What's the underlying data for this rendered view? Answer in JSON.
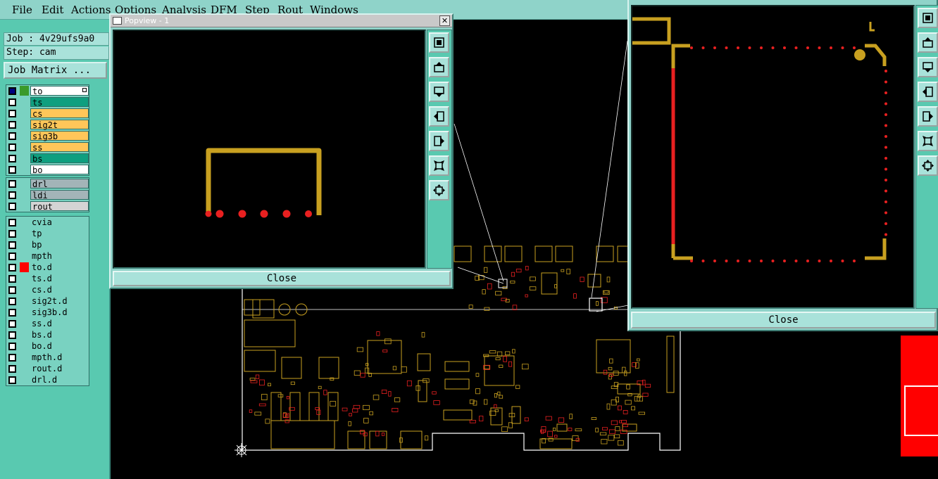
{
  "menu": [
    "File",
    "Edit",
    "Actions",
    "Options",
    "Analysis",
    "DFM",
    "Step",
    "Rout",
    "Windows"
  ],
  "info": {
    "job": "Job : 4v29ufs9a0",
    "step": "Step: cam",
    "job_matrix": "Job Matrix ..."
  },
  "layer_groups": [
    [
      {
        "name": "to",
        "bg": "#ffffff",
        "checked": true,
        "color": "#3a9a2a",
        "marker": true
      },
      {
        "name": "ts",
        "bg": "#0f9f7f"
      },
      {
        "name": "cs",
        "bg": "#ffc659"
      },
      {
        "name": "sig2t",
        "bg": "#ffc659"
      },
      {
        "name": "sig3b",
        "bg": "#ffc659"
      },
      {
        "name": "ss",
        "bg": "#ffc659"
      },
      {
        "name": "bs",
        "bg": "#0f9f7f"
      },
      {
        "name": "bo",
        "bg": "#ffffff"
      }
    ],
    [
      {
        "name": "drl",
        "bg": "#a3b4b8"
      },
      {
        "name": "ldi",
        "bg": "#a3b4b8"
      },
      {
        "name": "rout",
        "bg": "#d4d4d4"
      }
    ],
    [
      {
        "name": "cvia",
        "bg": "#79d2c1"
      },
      {
        "name": "tp",
        "bg": "#79d2c1"
      },
      {
        "name": "bp",
        "bg": "#79d2c1"
      },
      {
        "name": "mpth",
        "bg": "#79d2c1"
      },
      {
        "name": "to.d",
        "bg": "#79d2c1",
        "color": "#ff0000"
      },
      {
        "name": "ts.d",
        "bg": "#79d2c1"
      },
      {
        "name": "cs.d",
        "bg": "#79d2c1"
      },
      {
        "name": "sig2t.d",
        "bg": "#79d2c1"
      },
      {
        "name": "sig3b.d",
        "bg": "#79d2c1"
      },
      {
        "name": "ss.d",
        "bg": "#79d2c1"
      },
      {
        "name": "bs.d",
        "bg": "#79d2c1"
      },
      {
        "name": "bo.d",
        "bg": "#79d2c1"
      },
      {
        "name": "mpth.d",
        "bg": "#79d2c1"
      },
      {
        "name": "rout.d",
        "bg": "#79d2c1"
      },
      {
        "name": "drl.d",
        "bg": "#79d2c1"
      }
    ]
  ],
  "popview1": {
    "title": "Popview - 1",
    "close": "Close",
    "close_glyph": "✕"
  },
  "popview2": {
    "close": "Close"
  },
  "colors": {
    "trace": "#c8a020",
    "pad": "#e82020",
    "outline": "#ffffff"
  },
  "icons": [
    "zoom-in-icon",
    "pan-up-icon",
    "pan-down-icon",
    "pan-left-icon",
    "pan-right-icon",
    "fit-icon",
    "expand-icon"
  ]
}
